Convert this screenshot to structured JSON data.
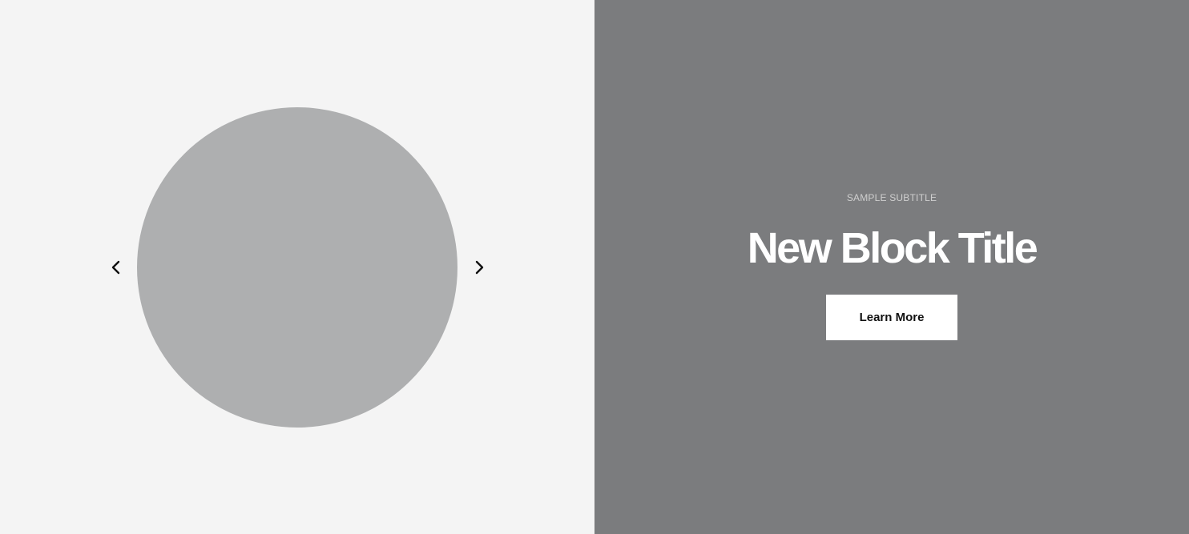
{
  "slider": {
    "prev_icon": "chevron-left-icon",
    "next_icon": "chevron-right-icon",
    "image_shape": "circle-placeholder"
  },
  "block": {
    "subtitle": "SAMPLE SUBTITLE",
    "title": "New Block Title",
    "cta_label": "Learn More"
  },
  "colors": {
    "left_background": "#f4f4f4",
    "right_background": "#7b7c7e",
    "placeholder": "#aeafb0",
    "button_background": "#ffffff",
    "button_text": "#111111"
  }
}
